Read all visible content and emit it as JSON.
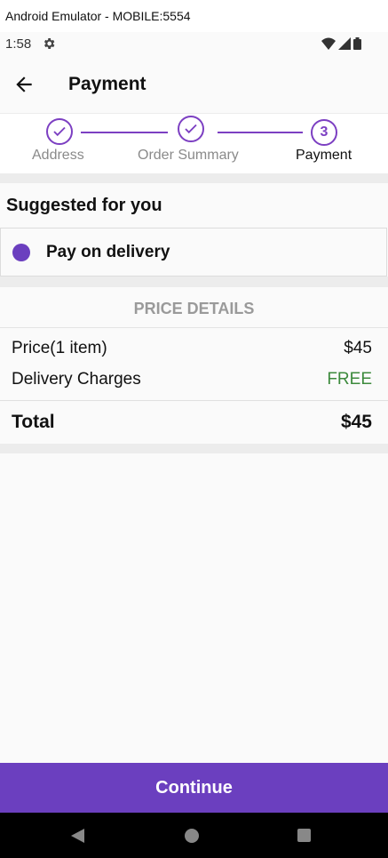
{
  "window": {
    "title": "Android Emulator - MOBILE:5554"
  },
  "status_bar": {
    "time": "1:58",
    "icons": [
      "gear-icon",
      "wifi-icon",
      "signal-icon",
      "battery-icon"
    ]
  },
  "app_bar": {
    "title": "Payment",
    "back_icon": "arrow-left-icon"
  },
  "stepper": {
    "steps": [
      {
        "label": "Address",
        "state": "done"
      },
      {
        "label": "Order Summary",
        "state": "done"
      },
      {
        "label": "Payment",
        "state": "active",
        "number": "3"
      }
    ]
  },
  "suggested": {
    "title": "Suggested for you"
  },
  "payment_option": {
    "label": "Pay on delivery",
    "selected": true
  },
  "price_details": {
    "header": "PRICE DETAILS",
    "rows": [
      {
        "label": "Price(1 item)",
        "value": "$45"
      },
      {
        "label": "Delivery Charges",
        "value": "FREE"
      }
    ],
    "total_label": "Total",
    "total_value": "$45"
  },
  "continue_button": {
    "label": "Continue"
  },
  "colors": {
    "accent": "#6b3fbf",
    "free": "#3c8a3c",
    "muted": "#9a9a9a"
  }
}
